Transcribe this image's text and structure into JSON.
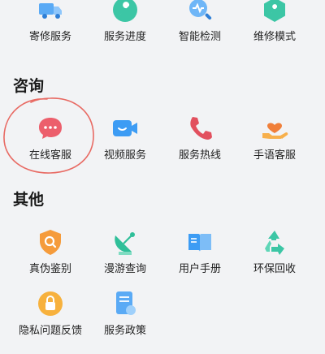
{
  "rows": {
    "top": [
      {
        "label": "寄修服务",
        "icon": "truck-icon"
      },
      {
        "label": "服务进度",
        "icon": "wrench-icon"
      },
      {
        "label": "智能检测",
        "icon": "magnifier-pulse-icon"
      },
      {
        "label": "维修模式",
        "icon": "hexagon-wrench-icon"
      }
    ],
    "consult_items": [
      {
        "label": "在线客服",
        "icon": "chat-bubble-icon"
      },
      {
        "label": "视频服务",
        "icon": "video-camera-icon"
      },
      {
        "label": "服务热线",
        "icon": "phone-icon"
      },
      {
        "label": "手语客服",
        "icon": "sign-language-icon"
      }
    ],
    "other_items": [
      {
        "label": "真伪鉴别",
        "icon": "shield-search-icon"
      },
      {
        "label": "漫游查询",
        "icon": "satellite-dish-icon"
      },
      {
        "label": "用户手册",
        "icon": "book-icon"
      },
      {
        "label": "环保回收",
        "icon": "recycle-icon"
      }
    ],
    "bottom": [
      {
        "label": "隐私问题反馈",
        "icon": "lock-icon"
      },
      {
        "label": "服务政策",
        "icon": "document-icon"
      }
    ]
  },
  "sections": {
    "consult_title": "咨询",
    "other_title": "其他"
  },
  "colors": {
    "background": "#f2f3f5",
    "blue": "#4ea1f5",
    "teal": "#36c3a7",
    "orange": "#f7a54a",
    "red": "#e6606a",
    "annotation": "#e86a63"
  }
}
